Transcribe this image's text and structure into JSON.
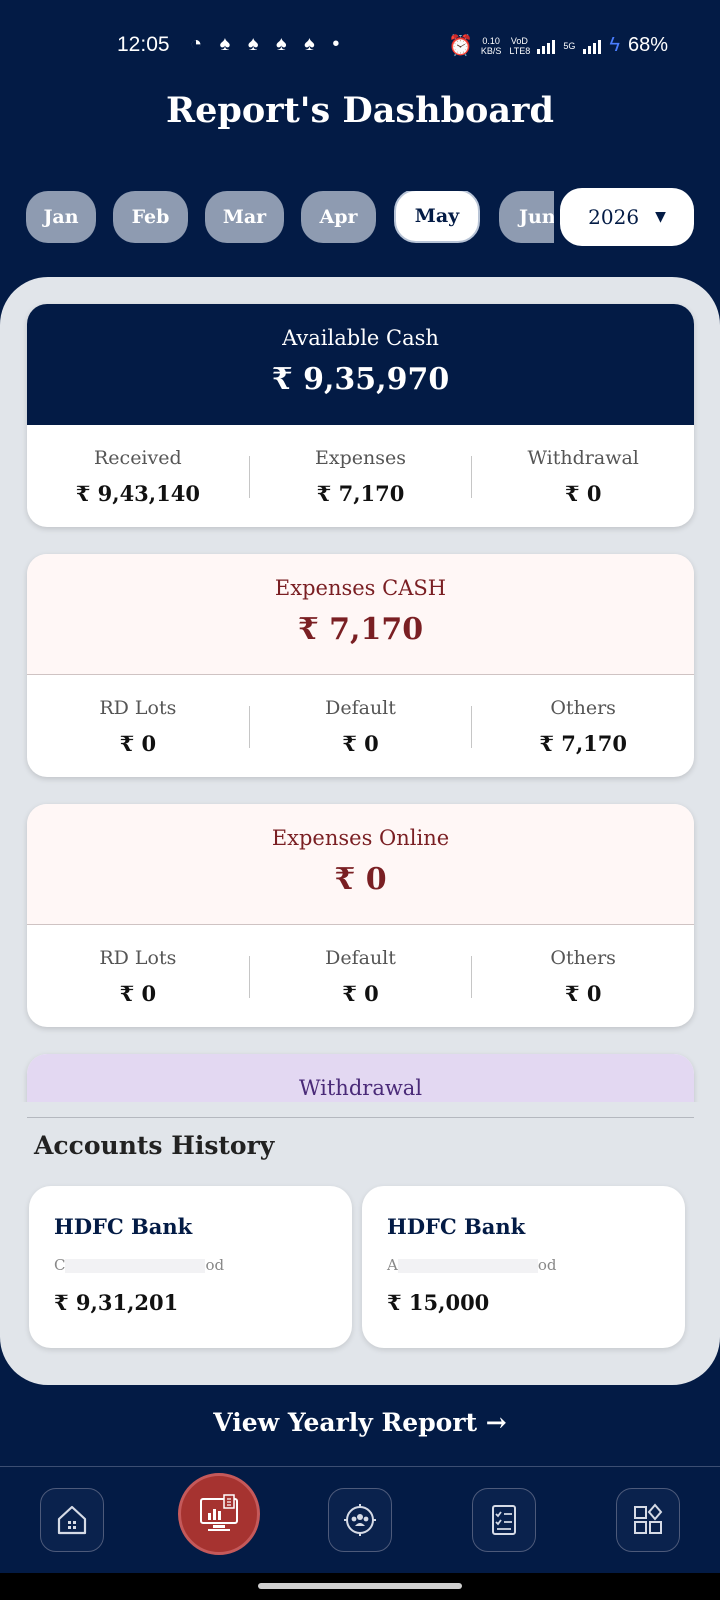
{
  "status_bar": {
    "time": "12:05",
    "notif_icons": "◔ ♠ ♠ ♠ ♠ •",
    "speed": "0.10",
    "speed_unit": "KB/S",
    "volte": "VoD LTE8",
    "net": "5G",
    "battery": "68%"
  },
  "title": "Report's Dashboard",
  "months": [
    {
      "label": "Jan"
    },
    {
      "label": "Feb"
    },
    {
      "label": "Mar"
    },
    {
      "label": "Apr"
    },
    {
      "label": "May"
    },
    {
      "label": "Jun"
    }
  ],
  "selected_month": "May",
  "year": {
    "value": "2026",
    "arrow": "▼"
  },
  "available": {
    "label": "Available Cash",
    "value": "₹ 9,35,970",
    "cols": [
      {
        "label": "Received",
        "value": "₹ 9,43,140"
      },
      {
        "label": "Expenses",
        "value": "₹ 7,170"
      },
      {
        "label": "Withdrawal",
        "value": "₹ 0"
      }
    ]
  },
  "expenses_cash": {
    "label": "Expenses CASH",
    "value": "₹ 7,170",
    "cols": [
      {
        "label": "RD Lots",
        "value": "₹ 0"
      },
      {
        "label": "Default",
        "value": "₹ 0"
      },
      {
        "label": "Others",
        "value": "₹ 7,170"
      }
    ]
  },
  "expenses_online": {
    "label": "Expenses Online",
    "value": "₹ 0",
    "cols": [
      {
        "label": "RD Lots",
        "value": "₹ 0"
      },
      {
        "label": "Default",
        "value": "₹ 0"
      },
      {
        "label": "Others",
        "value": "₹ 0"
      }
    ]
  },
  "withdrawal": {
    "label": "Withdrawal"
  },
  "accounts_history": {
    "title": "Accounts History",
    "items": [
      {
        "bank": "HDFC Bank",
        "sub_start": "C",
        "sub_end": "od",
        "amount": "₹ 9,31,201"
      },
      {
        "bank": "HDFC Bank",
        "sub_start": "A",
        "sub_end": "od",
        "amount": "₹ 15,000"
      }
    ]
  },
  "yearly_link": "View Yearly Report →",
  "nav": {
    "items": [
      "home-icon",
      "report-icon",
      "team-icon",
      "checklist-icon",
      "apps-icon"
    ],
    "active": "report-icon"
  },
  "colors": {
    "navy": "#031b45",
    "accent_red": "#a63330",
    "pink_bg": "#fff7f6",
    "purple_bg": "#e3d8f2"
  }
}
